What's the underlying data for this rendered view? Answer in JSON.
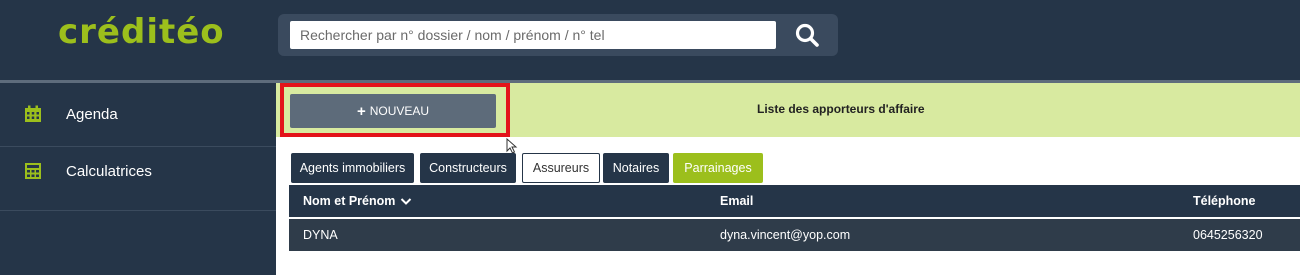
{
  "header": {
    "logo": "créditéo",
    "search": {
      "placeholder": "Rechercher par n° dossier / nom / prénom / n° tel",
      "value": ""
    }
  },
  "sidebar": {
    "items": [
      {
        "label": "Agenda",
        "icon": "calendar-icon"
      },
      {
        "label": "Calculatrices",
        "icon": "calculator-icon"
      }
    ]
  },
  "main": {
    "new_button": "NOUVEAU",
    "title": "Liste des apporteurs d'affaire",
    "tabs": [
      {
        "label": "Agents immobiliers",
        "style": "dark"
      },
      {
        "label": "Constructeurs",
        "style": "dark"
      },
      {
        "label": "Assureurs",
        "style": "light"
      },
      {
        "label": "Notaires",
        "style": "dark"
      },
      {
        "label": "Parrainages",
        "style": "active"
      }
    ],
    "table": {
      "columns": [
        "Nom et Prénom",
        "Email",
        "Téléphone"
      ],
      "rows": [
        [
          "DYNA",
          "dyna.vincent@yop.com",
          "0645256320"
        ]
      ]
    }
  },
  "colors": {
    "brand_green": "#9cbf1c",
    "navy": "#253548",
    "band": "#d8eaa0",
    "highlight": "#e3131a"
  }
}
